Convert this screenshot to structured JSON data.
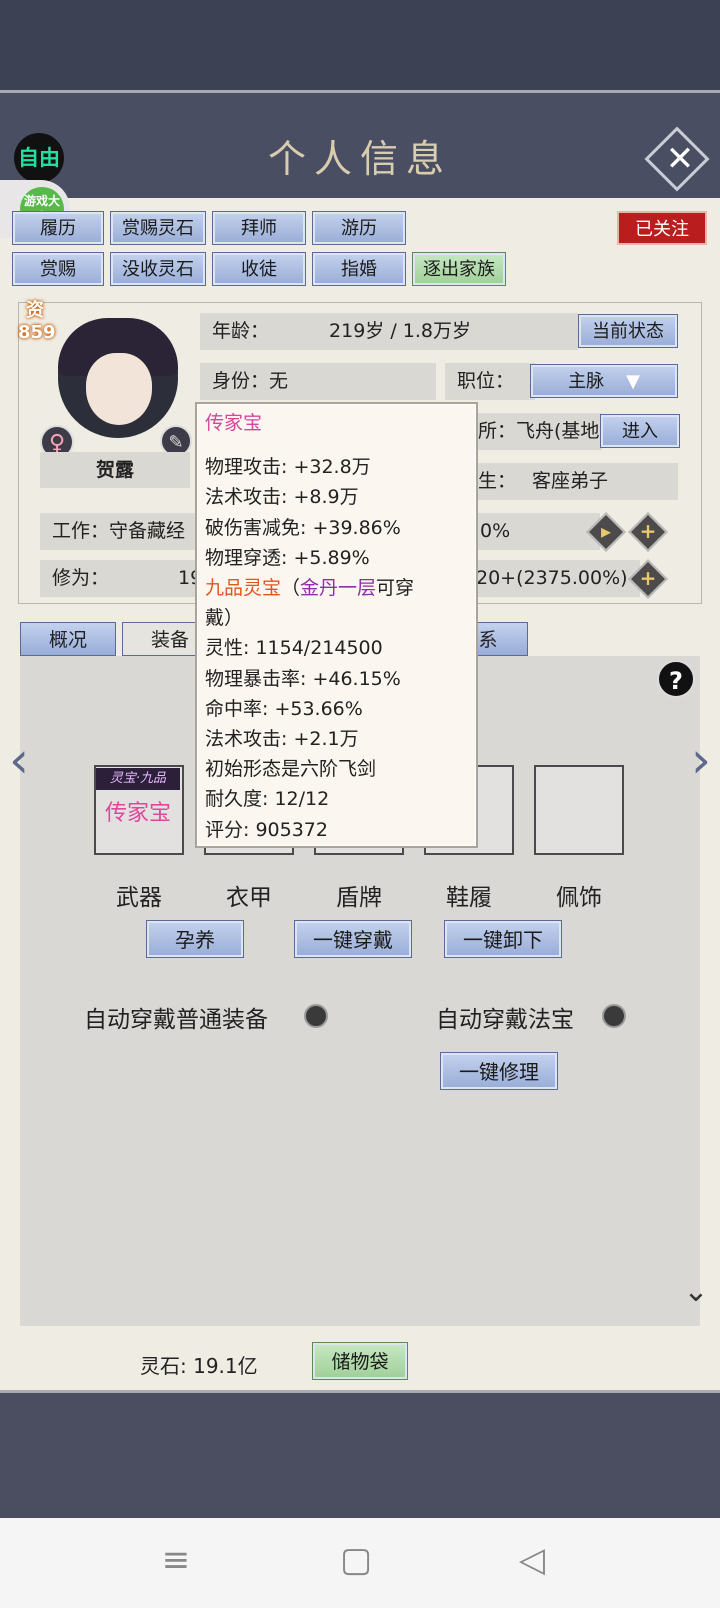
{
  "header": {
    "title": "个人信息",
    "free_label": "自由",
    "game_badge": "游戏大宝",
    "close_glyph": "✕"
  },
  "action_buttons_row1": [
    "履历",
    "赏赐灵石",
    "拜师",
    "游历"
  ],
  "action_buttons_row2": [
    "赏赐",
    "没收灵石",
    "收徒",
    "指婚",
    "逐出家族"
  ],
  "followed_label": "已关注",
  "character": {
    "aptitude_label": "资",
    "aptitude_value": "859",
    "name": "贺露",
    "gender_glyph": "♀",
    "age_label": "年龄：",
    "age_value": "219岁 / 1.8万岁",
    "state_button": "当前状态",
    "identity_label": "身份：",
    "identity_value": "无",
    "position_label": "职位：",
    "position_value": "主脉",
    "residence_text": "所：飞舟(基地",
    "enter_button": "进入",
    "disciple_label": "生：",
    "disciple_value": "客座弟子",
    "work_text": "工作：守备藏经",
    "work_percent": "0%",
    "cultivation_label": "修为：",
    "cultivation_partial": "19",
    "cultivation_rate": "20+(2375.00%)"
  },
  "tabs": [
    "概况",
    "装备",
    "系"
  ],
  "equipment": {
    "slots": [
      "武器",
      "衣甲",
      "盾牌",
      "鞋履",
      "佩饰"
    ],
    "weapon_badge": "灵宝·九品",
    "weapon_name": "传家宝",
    "buttons": [
      "孕养",
      "一键穿戴",
      "一键卸下"
    ],
    "auto_normal": "自动穿戴普通装备",
    "auto_treasure": "自动穿戴法宝",
    "repair_button": "一键修理",
    "help_glyph": "?"
  },
  "tooltip": {
    "title": "传家宝",
    "lines_before": [
      "物理攻击: +32.8万",
      "法术攻击: +8.9万",
      "破伤害减免: +39.86%",
      "物理穿透: +5.89%"
    ],
    "grade_line": {
      "grade": "九品灵宝",
      "open": "（",
      "realm": "金丹一层",
      "tail": "可穿"
    },
    "grade_line2": "戴）",
    "lines_after": [
      "灵性: 1154/214500",
      "物理暴击率: +46.15%",
      "命中率: +53.66%",
      "法术攻击: +2.1万",
      "初始形态是六阶飞剑",
      "耐久度: 12/12",
      "评分: 905372"
    ]
  },
  "footer": {
    "spirit_stone_label": "灵石: 19.1亿",
    "storage_button": "储物袋"
  },
  "colors": {
    "accent_blue": "#98acd6",
    "followed_red": "#b91d1d",
    "treasure_pink": "#d6459b",
    "grade_orange": "#e0561d",
    "realm_purple": "#8e2ea8"
  }
}
